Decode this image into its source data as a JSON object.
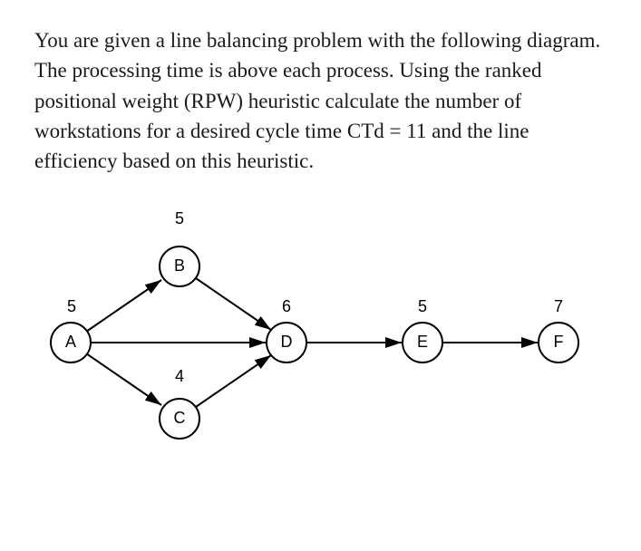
{
  "problem": {
    "text": "You are given a line balancing problem with the following diagram. The processing time is above each process. Using the ranked positional weight (RPW) heuristic calculate the number of workstations for a desired cycle time CTd = 11 and the line efficiency based on this heuristic."
  },
  "diagram": {
    "nodes": {
      "A": {
        "label": "A",
        "time": "5"
      },
      "B": {
        "label": "B",
        "time": "5"
      },
      "C": {
        "label": "C",
        "time": "4"
      },
      "D": {
        "label": "D",
        "time": "6"
      },
      "E": {
        "label": "E",
        "time": "5"
      },
      "F": {
        "label": "F",
        "time": "7"
      }
    },
    "edges": [
      {
        "from": "A",
        "to": "B"
      },
      {
        "from": "A",
        "to": "C"
      },
      {
        "from": "A",
        "to": "D"
      },
      {
        "from": "B",
        "to": "D"
      },
      {
        "from": "C",
        "to": "D"
      },
      {
        "from": "D",
        "to": "E"
      },
      {
        "from": "E",
        "to": "F"
      }
    ],
    "parameters": {
      "cycle_time": 11,
      "heuristic": "RPW"
    }
  }
}
